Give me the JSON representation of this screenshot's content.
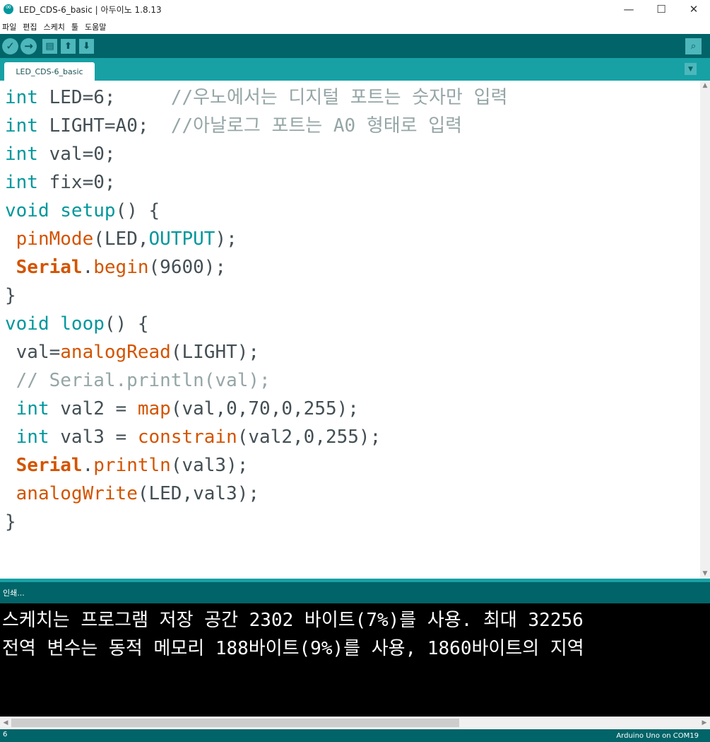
{
  "window": {
    "title": "LED_CDS-6_basic | 아두이노 1.8.13",
    "minimize": "—",
    "maximize": "☐",
    "close": "✕"
  },
  "menu": [
    "파일",
    "편집",
    "스케치",
    "툴",
    "도움말"
  ],
  "toolbar": {
    "verify_icon": "✓",
    "upload_icon": "→",
    "new_icon": "▤",
    "open_icon": "⬆",
    "save_icon": "⬇",
    "serial_monitor_icon": "⌕"
  },
  "tab": {
    "label": "LED_CDS-6_basic",
    "menu_icon": "▼"
  },
  "code": {
    "l1": {
      "type": "int",
      "body": " LED=6;     ",
      "comment": "//우노에서는 디지털 포트는 숫자만 입력"
    },
    "l2": {
      "type": "int",
      "body": " LIGHT=A0;  ",
      "comment": "//아날로그 포트는 A0 형태로 입력"
    },
    "l3": {
      "type": "int",
      "body": " val=0;"
    },
    "l4": {
      "type": "int",
      "body": " fix=0;"
    },
    "l5": {
      "type": "void",
      "space": " ",
      "fn": "setup",
      "rest": "() {"
    },
    "l6": {
      "indent": " ",
      "fn": "pinMode",
      "open": "(LED,",
      "const": "OUTPUT",
      "close": ");"
    },
    "l7": {
      "indent": " ",
      "cls": "Serial",
      "dot": ".",
      "fn": "begin",
      "rest": "(9600);"
    },
    "l8": {
      "text": "}"
    },
    "l9": {
      "type": "void",
      "space": " ",
      "fn": "loop",
      "rest": "() {"
    },
    "l10": {
      "pre": " val=",
      "fn": "analogRead",
      "rest": "(LIGHT);"
    },
    "l11": {
      "text": " // Serial.println(val);"
    },
    "l12": {
      "indent": " ",
      "type": "int",
      "mid": " val2 = ",
      "fn": "map",
      "rest": "(val,0,70,0,255);"
    },
    "l13": {
      "indent": " ",
      "type": "int",
      "mid": " val3 = ",
      "fn": "constrain",
      "rest": "(val2,0,255);"
    },
    "l14": {
      "indent": " ",
      "cls": "Serial",
      "dot": ".",
      "fn": "println",
      "rest": "(val3);"
    },
    "l15": {
      "indent": " ",
      "fn": "analogWrite",
      "rest": "(LED,val3);"
    },
    "l16": {
      "text": "}"
    }
  },
  "status": {
    "message": "인쇄..."
  },
  "console": {
    "line1": "스케치는 프로그램 저장 공간 2302 바이트(7%)를 사용. 최대 32256",
    "line2": "전역 변수는 동적 메모리 188바이트(9%)를 사용, 1860바이트의 지역"
  },
  "footer": {
    "line_number": "6",
    "board": "Arduino Uno on COM19"
  },
  "colors": {
    "keyword": "#00979c",
    "function": "#d35400",
    "comment": "#95a5a6",
    "toolbar": "#006468",
    "tabbar": "#17a1a5"
  }
}
